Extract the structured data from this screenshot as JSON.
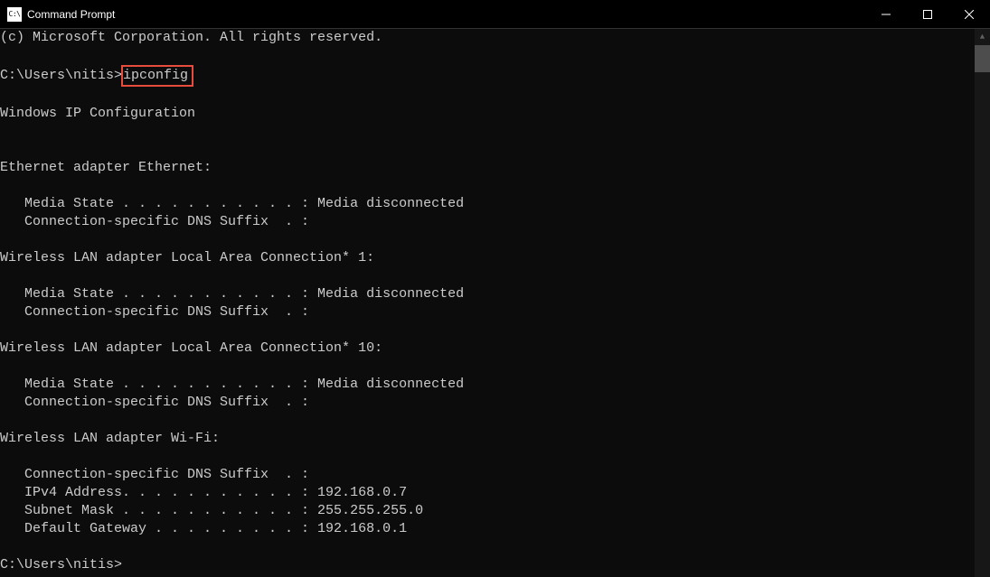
{
  "window": {
    "title": "Command Prompt",
    "icon_label": "C:\\"
  },
  "terminal": {
    "copyright": "(c) Microsoft Corporation. All rights reserved.",
    "prompt_path": "C:\\Users\\nitis>",
    "command": "ipconfig",
    "heading": "Windows IP Configuration",
    "adapters": [
      {
        "title": "Ethernet adapter Ethernet:",
        "lines": [
          "   Media State . . . . . . . . . . . : Media disconnected",
          "   Connection-specific DNS Suffix  . :"
        ]
      },
      {
        "title": "Wireless LAN adapter Local Area Connection* 1:",
        "lines": [
          "   Media State . . . . . . . . . . . : Media disconnected",
          "   Connection-specific DNS Suffix  . :"
        ]
      },
      {
        "title": "Wireless LAN adapter Local Area Connection* 10:",
        "lines": [
          "   Media State . . . . . . . . . . . : Media disconnected",
          "   Connection-specific DNS Suffix  . :"
        ]
      },
      {
        "title": "Wireless LAN adapter Wi-Fi:",
        "lines": [
          "   Connection-specific DNS Suffix  . :",
          "   IPv4 Address. . . . . . . . . . . : 192.168.0.7",
          "   Subnet Mask . . . . . . . . . . . : 255.255.255.0",
          "   Default Gateway . . . . . . . . . : 192.168.0.1"
        ]
      }
    ],
    "final_prompt": "C:\\Users\\nitis>"
  }
}
